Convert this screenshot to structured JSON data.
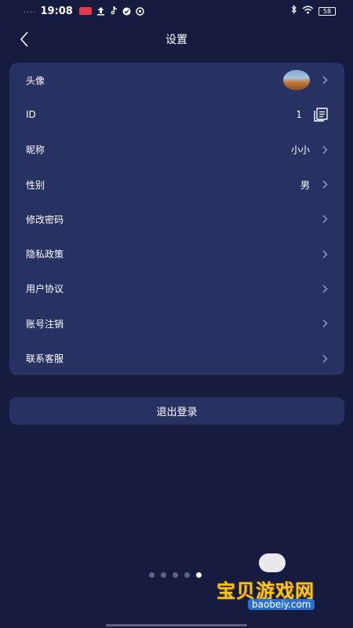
{
  "status_bar": {
    "time": "19:08",
    "signal_dots": "....",
    "battery": "58"
  },
  "navbar": {
    "title": "设置"
  },
  "settings": {
    "avatar_label": "头像",
    "id_label": "ID",
    "id_value": "1",
    "nickname_label": "昵称",
    "nickname_value": "小小",
    "gender_label": "性别",
    "gender_value": "男",
    "change_password_label": "修改密码",
    "privacy_policy_label": "隐私政策",
    "user_agreement_label": "用户协议",
    "account_cancel_label": "账号注销",
    "contact_service_label": "联系客服"
  },
  "logout_label": "退出登录",
  "page_indicator": {
    "count": 5,
    "active_index": 4
  },
  "watermark": {
    "title": "宝贝游戏网",
    "url": "baobeiy.com"
  },
  "colors": {
    "background": "#151c3f",
    "card": "#273262",
    "text": "#ffffff",
    "chevron": "#9aa2c4"
  }
}
